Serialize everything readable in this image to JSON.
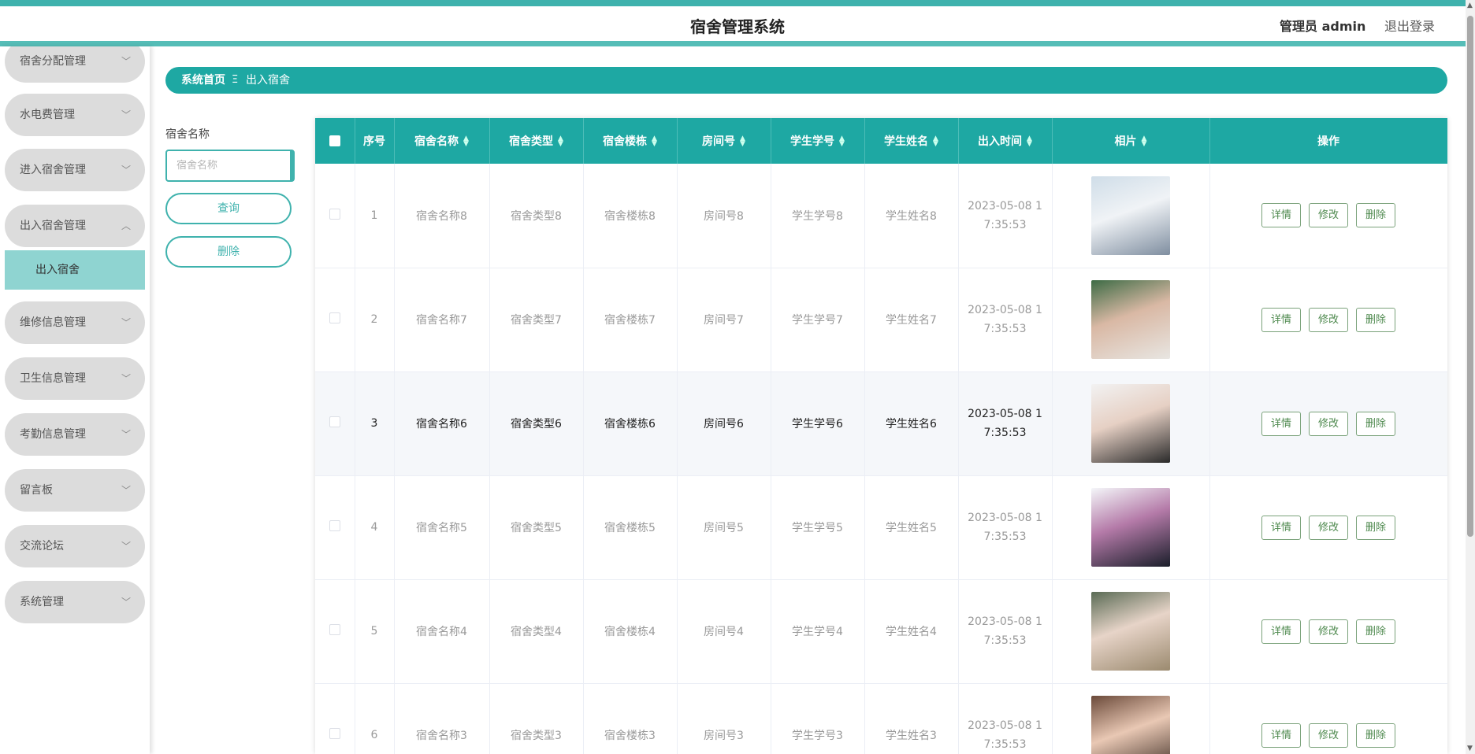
{
  "header": {
    "title": "宿舍管理系统",
    "admin_label": "管理员 admin",
    "logout_label": "退出登录"
  },
  "sidebar": {
    "items": [
      {
        "label": "宿舍分配管理"
      },
      {
        "label": "水电费管理"
      },
      {
        "label": "进入宿舍管理"
      },
      {
        "label": "出入宿舍管理"
      },
      {
        "label": "维修信息管理"
      },
      {
        "label": "卫生信息管理"
      },
      {
        "label": "考勤信息管理"
      },
      {
        "label": "留言板"
      },
      {
        "label": "交流论坛"
      },
      {
        "label": "系统管理"
      }
    ],
    "active_sub": "出入宿舍"
  },
  "breadcrumb": {
    "home": "系统首页",
    "separator": "Ξ",
    "current": "出入宿舍"
  },
  "search": {
    "label": "宿舍名称",
    "placeholder": "宿舍名称",
    "query_button": "查询",
    "delete_button": "删除"
  },
  "table": {
    "headers": {
      "index": "序号",
      "dorm_name": "宿舍名称",
      "dorm_type": "宿舍类型",
      "building": "宿舍楼栋",
      "room": "房间号",
      "student_id": "学生学号",
      "student_name": "学生姓名",
      "time": "出入时间",
      "photo": "相片",
      "ops": "操作"
    },
    "ops": {
      "detail": "详情",
      "edit": "修改",
      "delete": "删除"
    },
    "rows": [
      {
        "index": "1",
        "dorm_name": "宿舍名称8",
        "dorm_type": "宿舍类型8",
        "building": "宿舍楼栋8",
        "room": "房间号8",
        "student_id": "学生学号8",
        "student_name": "学生姓名8",
        "time_a": "2023-05-08 1",
        "time_b": "7:35:53"
      },
      {
        "index": "2",
        "dorm_name": "宿舍名称7",
        "dorm_type": "宿舍类型7",
        "building": "宿舍楼栋7",
        "room": "房间号7",
        "student_id": "学生学号7",
        "student_name": "学生姓名7",
        "time_a": "2023-05-08 1",
        "time_b": "7:35:53"
      },
      {
        "index": "3",
        "dorm_name": "宿舍名称6",
        "dorm_type": "宿舍类型6",
        "building": "宿舍楼栋6",
        "room": "房间号6",
        "student_id": "学生学号6",
        "student_name": "学生姓名6",
        "time_a": "2023-05-08 1",
        "time_b": "7:35:53"
      },
      {
        "index": "4",
        "dorm_name": "宿舍名称5",
        "dorm_type": "宿舍类型5",
        "building": "宿舍楼栋5",
        "room": "房间号5",
        "student_id": "学生学号5",
        "student_name": "学生姓名5",
        "time_a": "2023-05-08 1",
        "time_b": "7:35:53"
      },
      {
        "index": "5",
        "dorm_name": "宿舍名称4",
        "dorm_type": "宿舍类型4",
        "building": "宿舍楼栋4",
        "room": "房间号4",
        "student_id": "学生学号4",
        "student_name": "学生姓名4",
        "time_a": "2023-05-08 1",
        "time_b": "7:35:53"
      },
      {
        "index": "6",
        "dorm_name": "宿舍名称3",
        "dorm_type": "宿舍类型3",
        "building": "宿舍楼栋3",
        "room": "房间号3",
        "student_id": "学生学号3",
        "student_name": "学生姓名3",
        "time_a": "2023-05-08 1",
        "time_b": "7:35:53"
      }
    ]
  },
  "colors": {
    "accent": "#1ea8a3",
    "accent_light": "#8fd4d1",
    "menu_bg": "#dcdcdc"
  }
}
